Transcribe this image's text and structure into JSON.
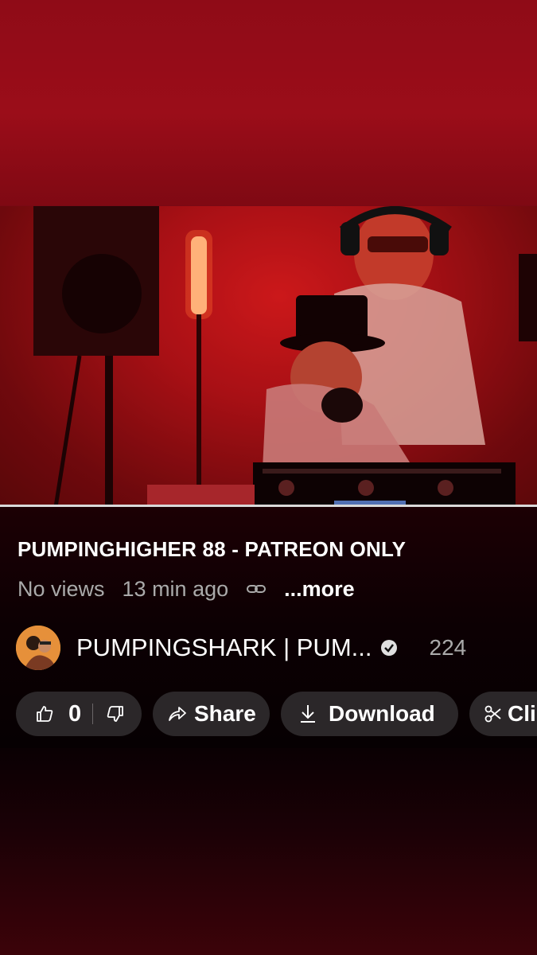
{
  "video": {
    "title": "PUMPINGHIGHER 88 - PATREON ONLY",
    "views": "No views",
    "time_ago": "13 min ago",
    "more_label": "...more",
    "progress_fraction": 0.0
  },
  "channel": {
    "name": "PUMPINGSHARK | PUM...",
    "subscribers": "224"
  },
  "actions": {
    "like_count": "0",
    "share_label": "Share",
    "download_label": "Download",
    "clip_label": "Cli"
  },
  "icons": {
    "like": "thumbs-up-icon",
    "dislike": "thumbs-down-icon",
    "share": "share-arrow-icon",
    "download": "download-icon",
    "clip": "scissors-icon",
    "link": "link-icon",
    "verified": "verified-badge-icon"
  },
  "colors": {
    "accent": "#ff0000",
    "pill_bg": "#2b2729",
    "meta_text": "#aaaaaa"
  }
}
